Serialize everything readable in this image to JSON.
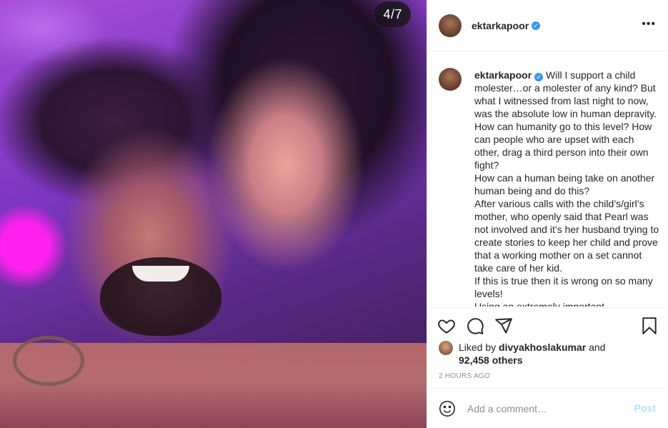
{
  "media": {
    "counter": "4/7",
    "image_icon": "photo"
  },
  "header": {
    "username": "ektarkapoor",
    "verified_icon": "verified-badge-icon",
    "more_icon": "more-options-icon",
    "more_label": "•••"
  },
  "caption": {
    "username": "ektarkapoor",
    "text": "Will I support a child molester…or a molester of any kind? But what I witnessed from last night to now, was the absolute low in human depravity. How can humanity go to this level? How can people who are upset with each other, drag a third person into their own fight?\nHow can a human being take on another human being and do this?\nAfter various calls with the child’s/girl’s mother, who openly said that Pearl was not involved and it’s her husband trying to create stories to keep her child and prove that a working mother on a set cannot take care of her kid.\nIf this is true then it is wrong on so many levels!\nUsing an extremely important"
  },
  "actions": {
    "like_icon": "heart-icon",
    "comment_icon": "comment-icon",
    "share_icon": "share-icon",
    "save_icon": "bookmark-icon"
  },
  "likes": {
    "prefix": "Liked by",
    "user": "divyakhoslakumar",
    "connector": "and",
    "count": "92,458 others"
  },
  "timestamp": "2 HOURS AGO",
  "comment": {
    "emoji_icon": "smiley-icon",
    "placeholder": "Add a comment…",
    "post_label": "Post"
  },
  "colors": {
    "accent": "#3897f0",
    "post_disabled": "#b2dffc",
    "muted": "#8e8e8e",
    "text": "#262626"
  }
}
